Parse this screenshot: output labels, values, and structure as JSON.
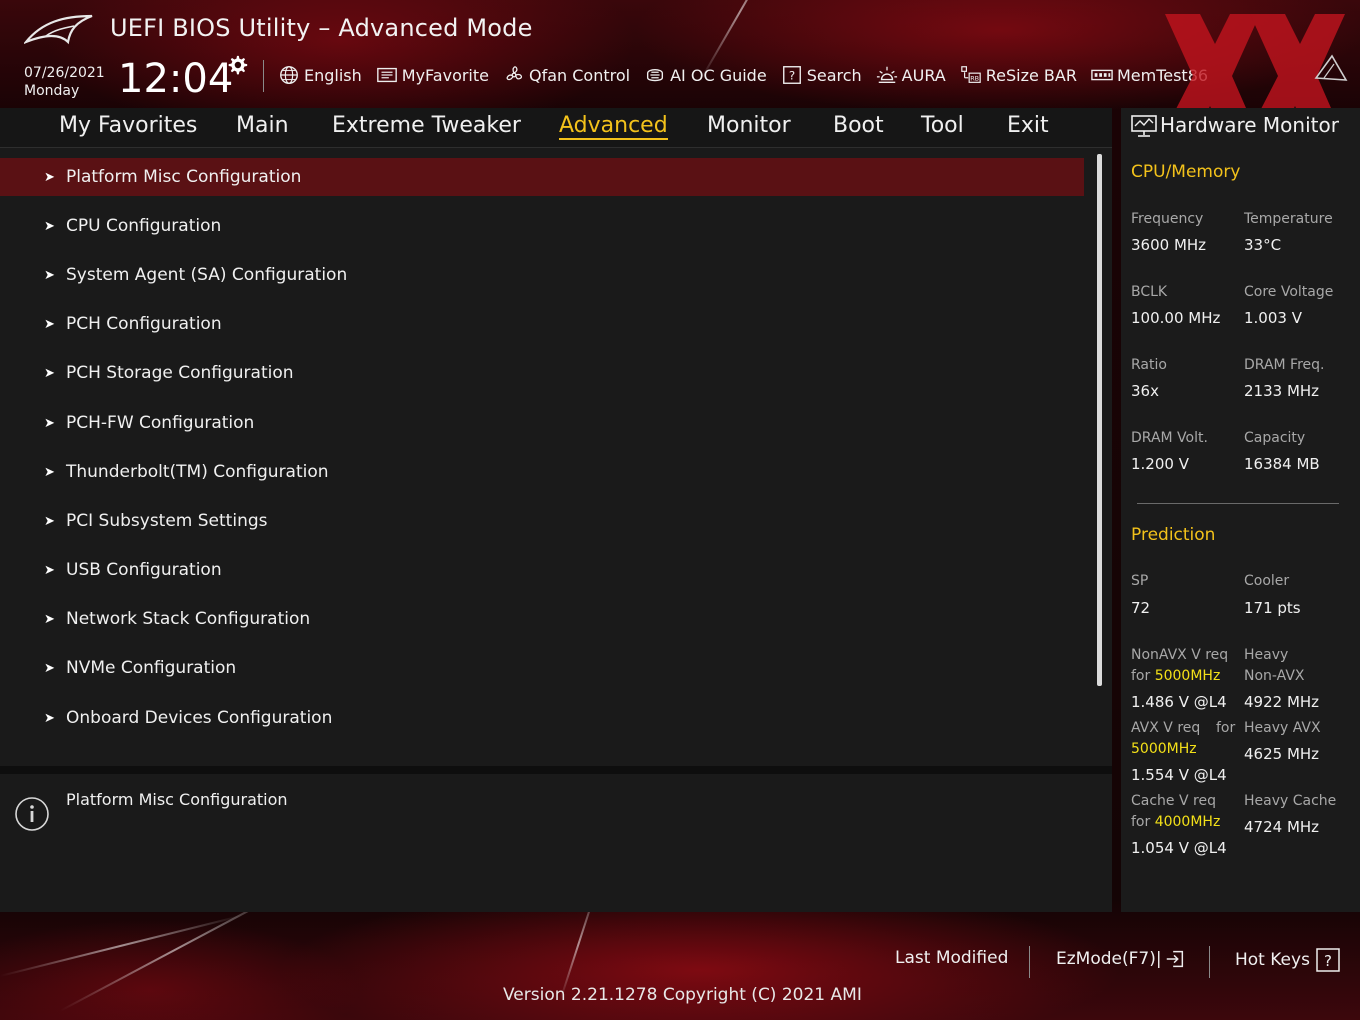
{
  "header": {
    "title": "UEFI BIOS Utility – Advanced Mode",
    "date": "07/26/2021",
    "day": "Monday",
    "time": "12:04",
    "toolbar": [
      {
        "label": "English",
        "icon": "globe-icon"
      },
      {
        "label": "MyFavorite",
        "icon": "favorite-list-icon"
      },
      {
        "label": "Qfan Control",
        "icon": "fan-icon"
      },
      {
        "label": "AI OC Guide",
        "icon": "ai-chip-icon"
      },
      {
        "label": "Search",
        "icon": "search-question-icon"
      },
      {
        "label": "AURA",
        "icon": "aura-light-icon"
      },
      {
        "label": "ReSize BAR",
        "icon": "resize-bar-icon"
      },
      {
        "label": "MemTest86",
        "icon": "memory-icon"
      }
    ]
  },
  "nav": {
    "tabs": [
      "My Favorites",
      "Main",
      "Extreme Tweaker",
      "Advanced",
      "Monitor",
      "Boot",
      "Tool",
      "Exit"
    ],
    "active": "Advanced"
  },
  "menu": {
    "items": [
      "Platform Misc Configuration",
      "CPU Configuration",
      "System Agent (SA) Configuration",
      "PCH Configuration",
      "PCH Storage Configuration",
      "PCH-FW Configuration",
      "Thunderbolt(TM) Configuration",
      "PCI Subsystem Settings",
      "USB Configuration",
      "Network Stack Configuration",
      "NVMe Configuration",
      "Onboard Devices Configuration"
    ],
    "selected": "Platform Misc Configuration"
  },
  "info": {
    "text": "Platform Misc Configuration"
  },
  "hardware_monitor": {
    "title": "Hardware Monitor",
    "cpu_memory": {
      "heading": "CPU/Memory",
      "frequency_label": "Frequency",
      "frequency": "3600 MHz",
      "temperature_label": "Temperature",
      "temperature": "33°C",
      "bclk_label": "BCLK",
      "bclk": "100.00 MHz",
      "core_voltage_label": "Core Voltage",
      "core_voltage": "1.003 V",
      "ratio_label": "Ratio",
      "ratio": "36x",
      "dram_freq_label": "DRAM Freq.",
      "dram_freq": "2133 MHz",
      "dram_volt_label": "DRAM Volt.",
      "dram_volt": "1.200 V",
      "capacity_label": "Capacity",
      "capacity": "16384 MB"
    },
    "prediction": {
      "heading": "Prediction",
      "sp_label": "SP",
      "sp": "72",
      "cooler_label": "Cooler",
      "cooler": "171 pts",
      "nonavx_label_1": "NonAVX V req",
      "nonavx_label_2": "for",
      "nonavx_freq": "5000MHz",
      "nonavx_value": "1.486 V @L4",
      "heavy_nonavx_label_1": "Heavy",
      "heavy_nonavx_label_2": "Non-AVX",
      "heavy_nonavx_value": "4922 MHz",
      "avx_label_1": "AVX V req",
      "avx_label_2": "for",
      "avx_freq": "5000MHz",
      "avx_value": "1.554 V @L4",
      "heavy_avx_label": "Heavy AVX",
      "heavy_avx_value": "4625 MHz",
      "cache_label_1": "Cache V req",
      "cache_label_2": "for",
      "cache_freq": "4000MHz",
      "cache_value": "1.054 V @L4",
      "heavy_cache_label": "Heavy Cache",
      "heavy_cache_value": "4724 MHz"
    }
  },
  "footer": {
    "last_modified": "Last Modified",
    "ezmode": "EzMode(F7)|",
    "hot_keys": "Hot Keys",
    "version": "Version 2.21.1278 Copyright (C) 2021 AMI"
  },
  "colors": {
    "accent": "#f3c21b",
    "selected_row": "#5a1114",
    "highlight_freq": "#f3e018"
  }
}
